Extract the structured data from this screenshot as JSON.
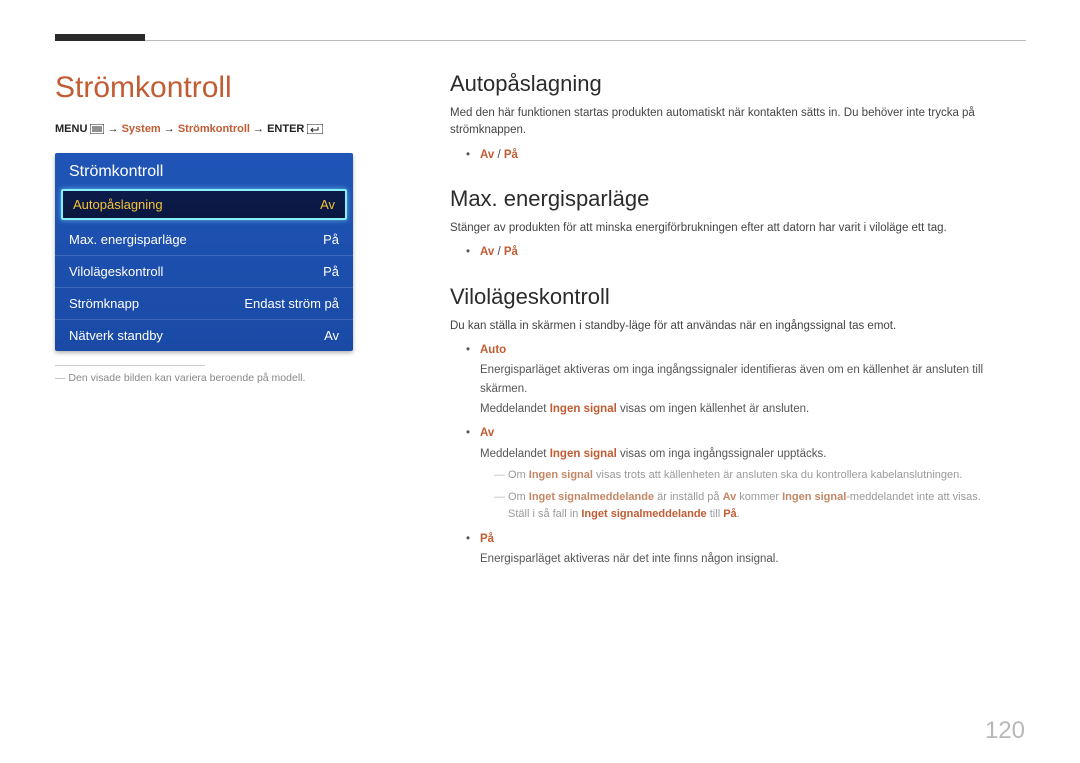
{
  "pageTitle": "Strömkontroll",
  "breadcrumb": {
    "menu": "MENU",
    "system": "System",
    "stromkontroll": "Strömkontroll",
    "enter": "ENTER"
  },
  "panel": {
    "title": "Strömkontroll",
    "rows": [
      {
        "label": "Autopåslagning",
        "value": "Av",
        "selected": true
      },
      {
        "label": "Max. energisparläge",
        "value": "På",
        "selected": false
      },
      {
        "label": "Vilolägeskontroll",
        "value": "På",
        "selected": false
      },
      {
        "label": "Strömknapp",
        "value": "Endast ström på",
        "selected": false
      },
      {
        "label": "Nätverk standby",
        "value": "Av",
        "selected": false
      }
    ]
  },
  "caption": "Den visade bilden kan variera beroende på modell.",
  "sections": {
    "auto": {
      "title": "Autopåslagning",
      "desc": "Med den här funktionen startas produkten automatiskt när kontakten sätts in. Du behöver inte trycka på strömknappen.",
      "opts_av": "Av",
      "opts_sep": " / ",
      "opts_pa": "På"
    },
    "max": {
      "title": "Max. energisparläge",
      "desc": "Stänger av produkten för att minska energiförbrukningen efter att datorn har varit i viloläge ett tag.",
      "opts_av": "Av",
      "opts_sep": " / ",
      "opts_pa": "På"
    },
    "vilo": {
      "title": "Vilolägeskontroll",
      "desc": "Du kan ställa in skärmen i standby-läge för att användas när en ingångssignal tas emot.",
      "auto_label": "Auto",
      "auto_line1": "Energisparläget aktiveras om inga ingångssignaler identifieras även om en källenhet är ansluten till skärmen.",
      "auto_line2_a": "Meddelandet ",
      "auto_line2_b": "Ingen signal",
      "auto_line2_c": " visas om ingen källenhet är ansluten.",
      "av_label": "Av",
      "av_line1_a": "Meddelandet ",
      "av_line1_b": "Ingen signal",
      "av_line1_c": " visas om inga ingångssignaler upptäcks.",
      "note1_a": "Om ",
      "note1_b": "Ingen signal",
      "note1_c": " visas trots att källenheten är ansluten ska du kontrollera kabelanslutningen.",
      "note2_a": "Om ",
      "note2_b": "Inget signalmeddelande",
      "note2_c": " är inställd på ",
      "note2_d": "Av",
      "note2_e": " kommer ",
      "note2_f": "Ingen signal",
      "note2_g": "-meddelandet inte att visas.",
      "note2_sub_a": "Ställ i så fall in ",
      "note2_sub_b": "Inget signalmeddelande",
      "note2_sub_c": " till ",
      "note2_sub_d": "På",
      "note2_sub_e": ".",
      "pa_label": "På",
      "pa_line": "Energisparläget aktiveras när det inte finns någon insignal."
    }
  },
  "pageNumber": "120"
}
